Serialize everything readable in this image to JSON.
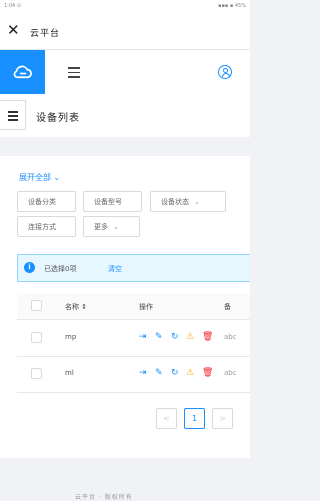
{
  "status_bar": {
    "left": "1:04 ⊙",
    "right": "▪▪▪ ▪ 45%"
  },
  "title_bar": {
    "title": "云平台",
    "close_icon": "close-icon"
  },
  "top_nav": {
    "logo_icon": "cloud-icon",
    "menu_icon": "hamburger-icon",
    "user_icon": "user-circle-icon",
    "accent": "#1890ff"
  },
  "page_header": {
    "title": "设备列表",
    "toggle_icon": "hamburger-icon"
  },
  "filters": {
    "expand_label": "展开全部",
    "buttons": [
      {
        "label": "设备分类",
        "has_arrow": false
      },
      {
        "label": "设备型号",
        "has_arrow": false
      },
      {
        "label": "设备状态",
        "has_arrow": true
      },
      {
        "label": "连接方式",
        "has_arrow": false
      },
      {
        "label": "更多",
        "has_arrow": true
      }
    ]
  },
  "alert": {
    "icon": "info-icon",
    "message": "已选择0项",
    "clear_label": "清空"
  },
  "table": {
    "columns": [
      {
        "label": "名称 ⇕"
      },
      {
        "label": "操作"
      },
      {
        "label": "备"
      }
    ],
    "rows": [
      {
        "name": "mp",
        "extra": "abc"
      },
      {
        "name": "ml",
        "extra": "abc"
      }
    ],
    "actions": [
      {
        "icon": "enter-icon",
        "glyph": "⇥",
        "color": "blue"
      },
      {
        "icon": "edit-icon",
        "glyph": "✎",
        "color": "blue"
      },
      {
        "icon": "restart-icon",
        "glyph": "↻",
        "color": "blue"
      },
      {
        "icon": "warning-icon",
        "glyph": "⚠",
        "color": "orange"
      },
      {
        "icon": "delete-icon",
        "glyph": "🗑",
        "color": "red"
      }
    ]
  },
  "pagination": {
    "prev": "<",
    "current": "1",
    "next": ">"
  },
  "footer": {
    "text": "云平台 · 版权所有"
  }
}
